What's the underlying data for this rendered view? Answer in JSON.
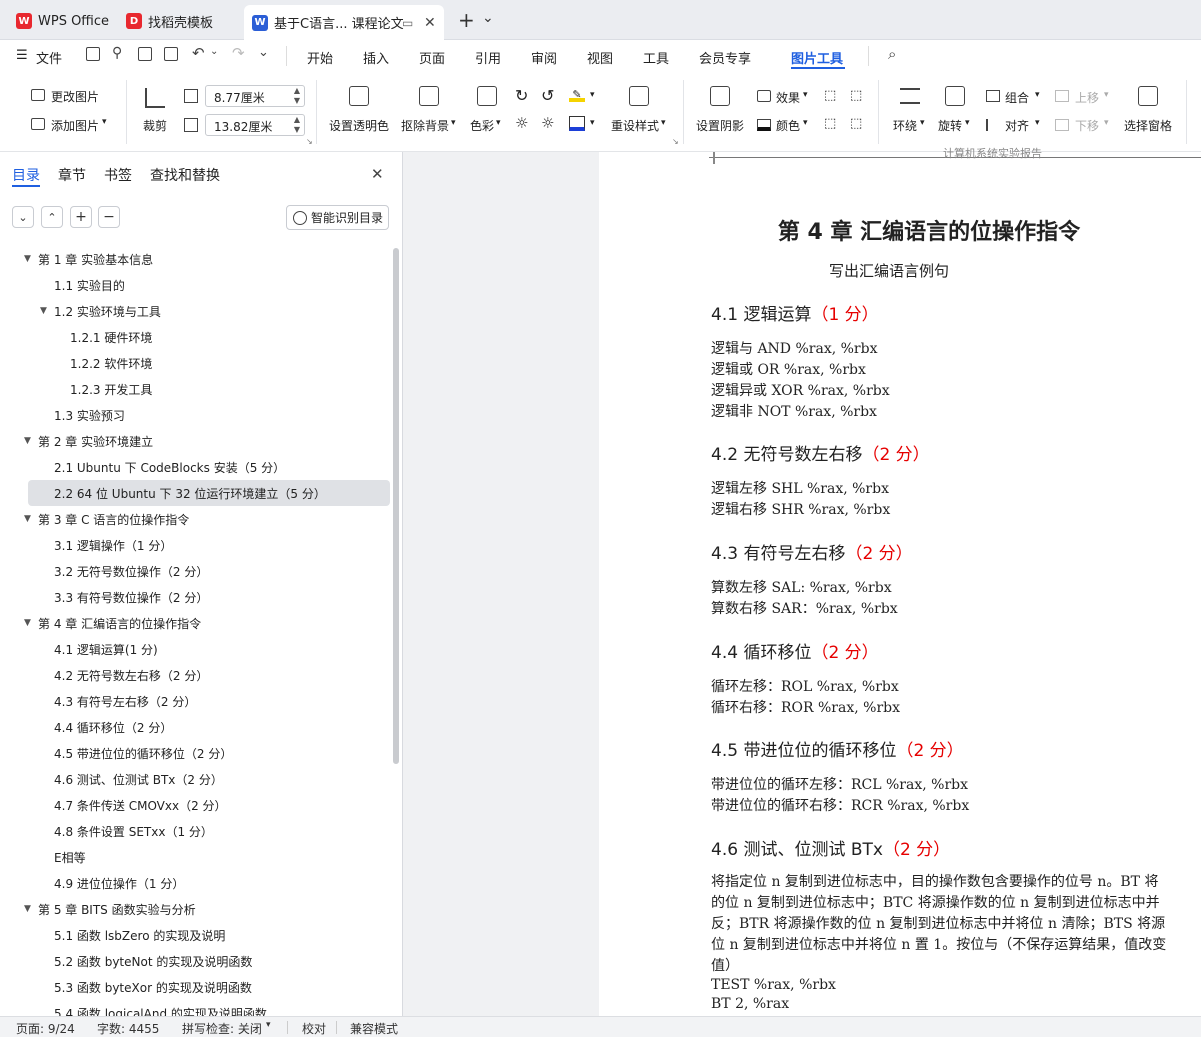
{
  "tabs": [
    {
      "label": "WPS Office",
      "color": "#e8282f"
    },
    {
      "label": "找稻壳模板",
      "color": "#e8282f"
    },
    {
      "label": "基于C语言... 课程论文",
      "color": "#2b5ed6"
    }
  ],
  "tabbar": {
    "new_tab": "+",
    "dropdown": "⌄"
  },
  "menu": {
    "file": "文件",
    "items": [
      "开始",
      "插入",
      "页面",
      "引用",
      "审阅",
      "视图",
      "工具",
      "会员专享"
    ],
    "active": "图片工具"
  },
  "ribbon": {
    "change_image": "更改图片",
    "add_image": "添加图片",
    "crop": "裁剪",
    "width": "8.77厘米",
    "height": "13.82厘米",
    "set_transparent": "设置透明色",
    "remove_bg": "抠除背景",
    "color": "色彩",
    "preset_style": "重设样式",
    "set_shadow": "设置阴影",
    "effect": "效果",
    "outline_color": "颜色",
    "wrap": "环绕",
    "rotate": "旋转",
    "group": "组合",
    "align": "对齐",
    "move_up": "上移",
    "move_down": "下移",
    "select_pane": "选择窗格"
  },
  "sidebar": {
    "tabs": [
      "目录",
      "章节",
      "书签",
      "查找和替换"
    ],
    "smart_btn": "智能识别目录",
    "toc": [
      {
        "label": "第 1 章  实验基本信息",
        "level": 0,
        "arrow": true
      },
      {
        "label": "1.1  实验目的",
        "level": 1
      },
      {
        "label": "1.2  实验环境与工具",
        "level": 1,
        "arrow": true
      },
      {
        "label": "1.2.1  硬件环境",
        "level": 2
      },
      {
        "label": "1.2.2  软件环境",
        "level": 2
      },
      {
        "label": "1.2.3  开发工具",
        "level": 2
      },
      {
        "label": "1.3  实验预习",
        "level": 1
      },
      {
        "label": "第 2 章  实验环境建立",
        "level": 0,
        "arrow": true
      },
      {
        "label": "2.1 Ubuntu 下 CodeBlocks 安装（5 分）",
        "level": 1
      },
      {
        "label": "2.2 64 位 Ubuntu 下 32 位运行环境建立（5 分）",
        "level": 1,
        "selected": true
      },
      {
        "label": "第 3 章  C 语言的位操作指令",
        "level": 0,
        "arrow": true
      },
      {
        "label": "3.1  逻辑操作（1 分）",
        "level": 1
      },
      {
        "label": "3.2  无符号数位操作（2 分）",
        "level": 1
      },
      {
        "label": "3.3  有符号数位操作（2 分）",
        "level": 1
      },
      {
        "label": "第 4 章  汇编语言的位操作指令",
        "level": 0,
        "arrow": true
      },
      {
        "label": "4.1  逻辑运算(1 分)",
        "level": 1
      },
      {
        "label": "4.2 无符号数左右移（2 分）",
        "level": 1
      },
      {
        "label": "4.3 有符号左右移（2 分）",
        "level": 1
      },
      {
        "label": "4.4 循环移位（2 分）",
        "level": 1
      },
      {
        "label": "4.5 带进位位的循环移位（2 分）",
        "level": 1
      },
      {
        "label": "4.6 测试、位测试 BTx（2 分）",
        "level": 1
      },
      {
        "label": "4.7 条件传送 CMOVxx（2 分）",
        "level": 1
      },
      {
        "label": "4.8 条件设置 SETxx（1 分）",
        "level": 1
      },
      {
        "label": "E相等",
        "level": 1
      },
      {
        "label": "4.9 进位位操作（1 分）",
        "level": 1
      },
      {
        "label": "第 5 章  BITS 函数实验与分析",
        "level": 0,
        "arrow": true
      },
      {
        "label": "5.1  函数 lsbZero 的实现及说明",
        "level": 1
      },
      {
        "label": "5.2  函数 byteNot 的实现及说明函数",
        "level": 1
      },
      {
        "label": "5.3  函数 byteXor 的实现及说明函数",
        "level": 1
      },
      {
        "label": "5.4  函数 logicalAnd 的实现及说明函数",
        "level": 1
      }
    ]
  },
  "document": {
    "header_text": "计算机系统实验报告",
    "chapter_title": "第 4 章  汇编语言的位操作指令",
    "subtitle": "写出汇编语言例句",
    "sections": [
      {
        "num": "4.1  逻辑运算",
        "pts": "（1 分）",
        "lines": [
          "逻辑与 AND      %rax, %rbx",
          "逻辑或 OR        %rax, %rbx",
          "逻辑异或 XOR %rax, %rbx",
          "逻辑非 NOT    %rax, %rbx"
        ]
      },
      {
        "num": "4.2 无符号数左右移",
        "pts": "（2 分）",
        "lines": [
          "逻辑左移 SHL       %rax, %rbx",
          "逻辑右移 SHR       %rax, %rbx"
        ]
      },
      {
        "num": "4.3 有符号左右移",
        "pts": "（2 分）",
        "lines": [
          "算数左移     SAL:     %rax, %rbx",
          "算数右移 SAR：%rax, %rbx"
        ]
      },
      {
        "num": "4.4 循环移位",
        "pts": "（2 分）",
        "lines": [
          "循环左移：ROL %rax, %rbx",
          "循环右移：ROR %rax, %rbx"
        ]
      },
      {
        "num": "4.5 带进位位的循环移位",
        "pts": "（2 分）",
        "lines": [
          "带进位位的循环左移：RCL %rax, %rbx",
          "带进位位的循环右移：RCR %rax, %rbx"
        ]
      },
      {
        "num": "4.6 测试、位测试 BTx",
        "pts": "（2 分）",
        "lines": []
      }
    ],
    "para_lines": [
      "将指定位 n 复制到进位标志中，目的操作数包含要操作的位号 n。BT 将",
      "的位 n 复制到进位标志中；BTC 将源操作数的位 n 复制到进位标志中并",
      "反；BTR 将源操作数的位 n 复制到进位标志中并将位 n 清除；BTS 将源",
      "位 n 复制到进位标志中并将位 n 置 1。按位与（不保存运算结果，值改变",
      "值）"
    ],
    "code_lines": [
      "TEST    %rax, %rbx",
      "BT 2, %rax"
    ]
  },
  "status": {
    "page": "页面: 9/24",
    "words": "字数: 4455",
    "spell": "拼写检查: 关闭",
    "proof": "校对",
    "compat": "兼容模式"
  }
}
